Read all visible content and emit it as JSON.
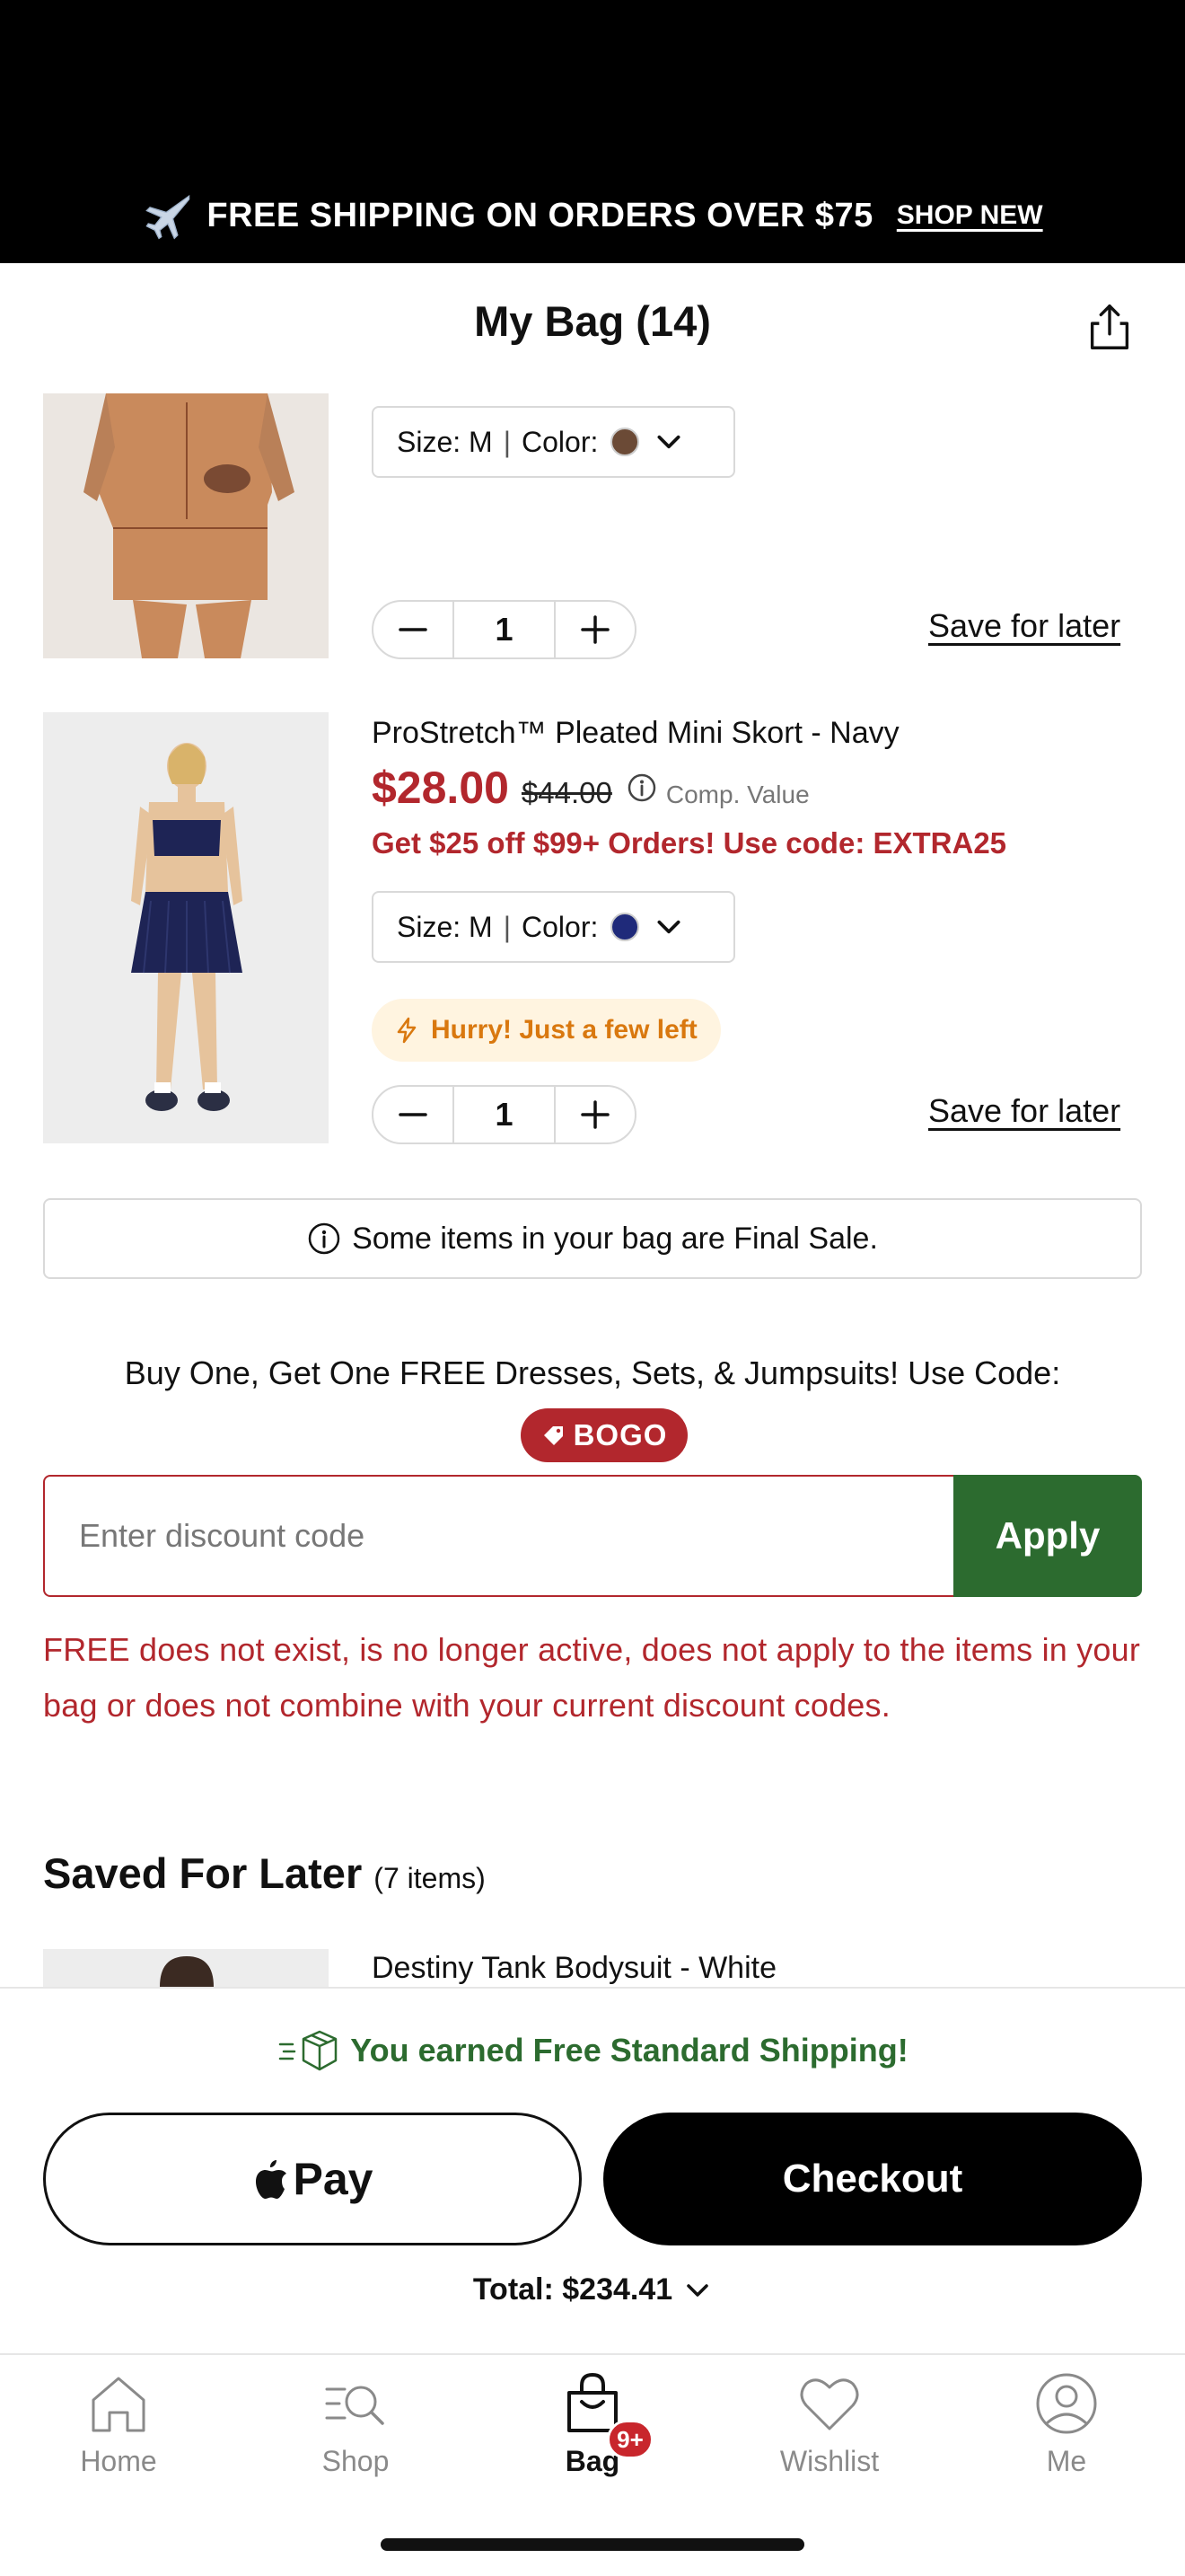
{
  "promo_banner": {
    "text": "FREE SHIPPING ON ORDERS OVER $75",
    "link": "SHOP NEW",
    "icon": "airplane-icon"
  },
  "header": {
    "title": "My Bag (14)",
    "share_icon": "share-icon"
  },
  "cart_items": [
    {
      "name": "",
      "size_label": "Size: M",
      "separator": "|",
      "color_label": "Color:",
      "color_swatch": "#6b4a36",
      "quantity": "1",
      "save_for_later": "Save for later"
    },
    {
      "name": "ProStretch™ Pleated Mini Skort - Navy",
      "price": "$28.00",
      "original_price": "$44.00",
      "comp_label": "Comp. Value",
      "promo": "Get $25 off $99+ Orders! Use code: EXTRA25",
      "size_label": "Size: M",
      "separator": "|",
      "color_label": "Color:",
      "color_swatch": "#1f2a7a",
      "stock_alert": "Hurry! Just a few left",
      "quantity": "1",
      "save_for_later": "Save for later"
    }
  ],
  "final_sale_notice": "Some items in your bag are Final Sale.",
  "promotion": {
    "text": "Buy One, Get One FREE Dresses, Sets, & Jumpsuits! Use Code:",
    "code": "BOGO"
  },
  "discount": {
    "placeholder": "Enter discount code",
    "apply_label": "Apply",
    "error": "FREE does not exist, is no longer active, does not apply to the items in your bag or does not combine with your current discount codes."
  },
  "saved_for_later": {
    "title": "Saved For Later",
    "count": "(7 items)",
    "first_item": "Destiny Tank Bodysuit - White"
  },
  "checkout": {
    "shipping_message": "You earned Free Standard Shipping!",
    "apple_pay_label": "Pay",
    "checkout_label": "Checkout",
    "total": "Total: $234.41"
  },
  "tabbar": {
    "home": "Home",
    "shop": "Shop",
    "bag": "Bag",
    "bag_badge": "9+",
    "wishlist": "Wishlist",
    "me": "Me",
    "active": "Bag"
  },
  "colors": {
    "accent_red": "#b2272d",
    "apply_green": "#2c6b2f",
    "shipping_green": "#2c6b2f",
    "hurry_orange": "#d9780f",
    "hurry_bg": "#fff4e0"
  }
}
